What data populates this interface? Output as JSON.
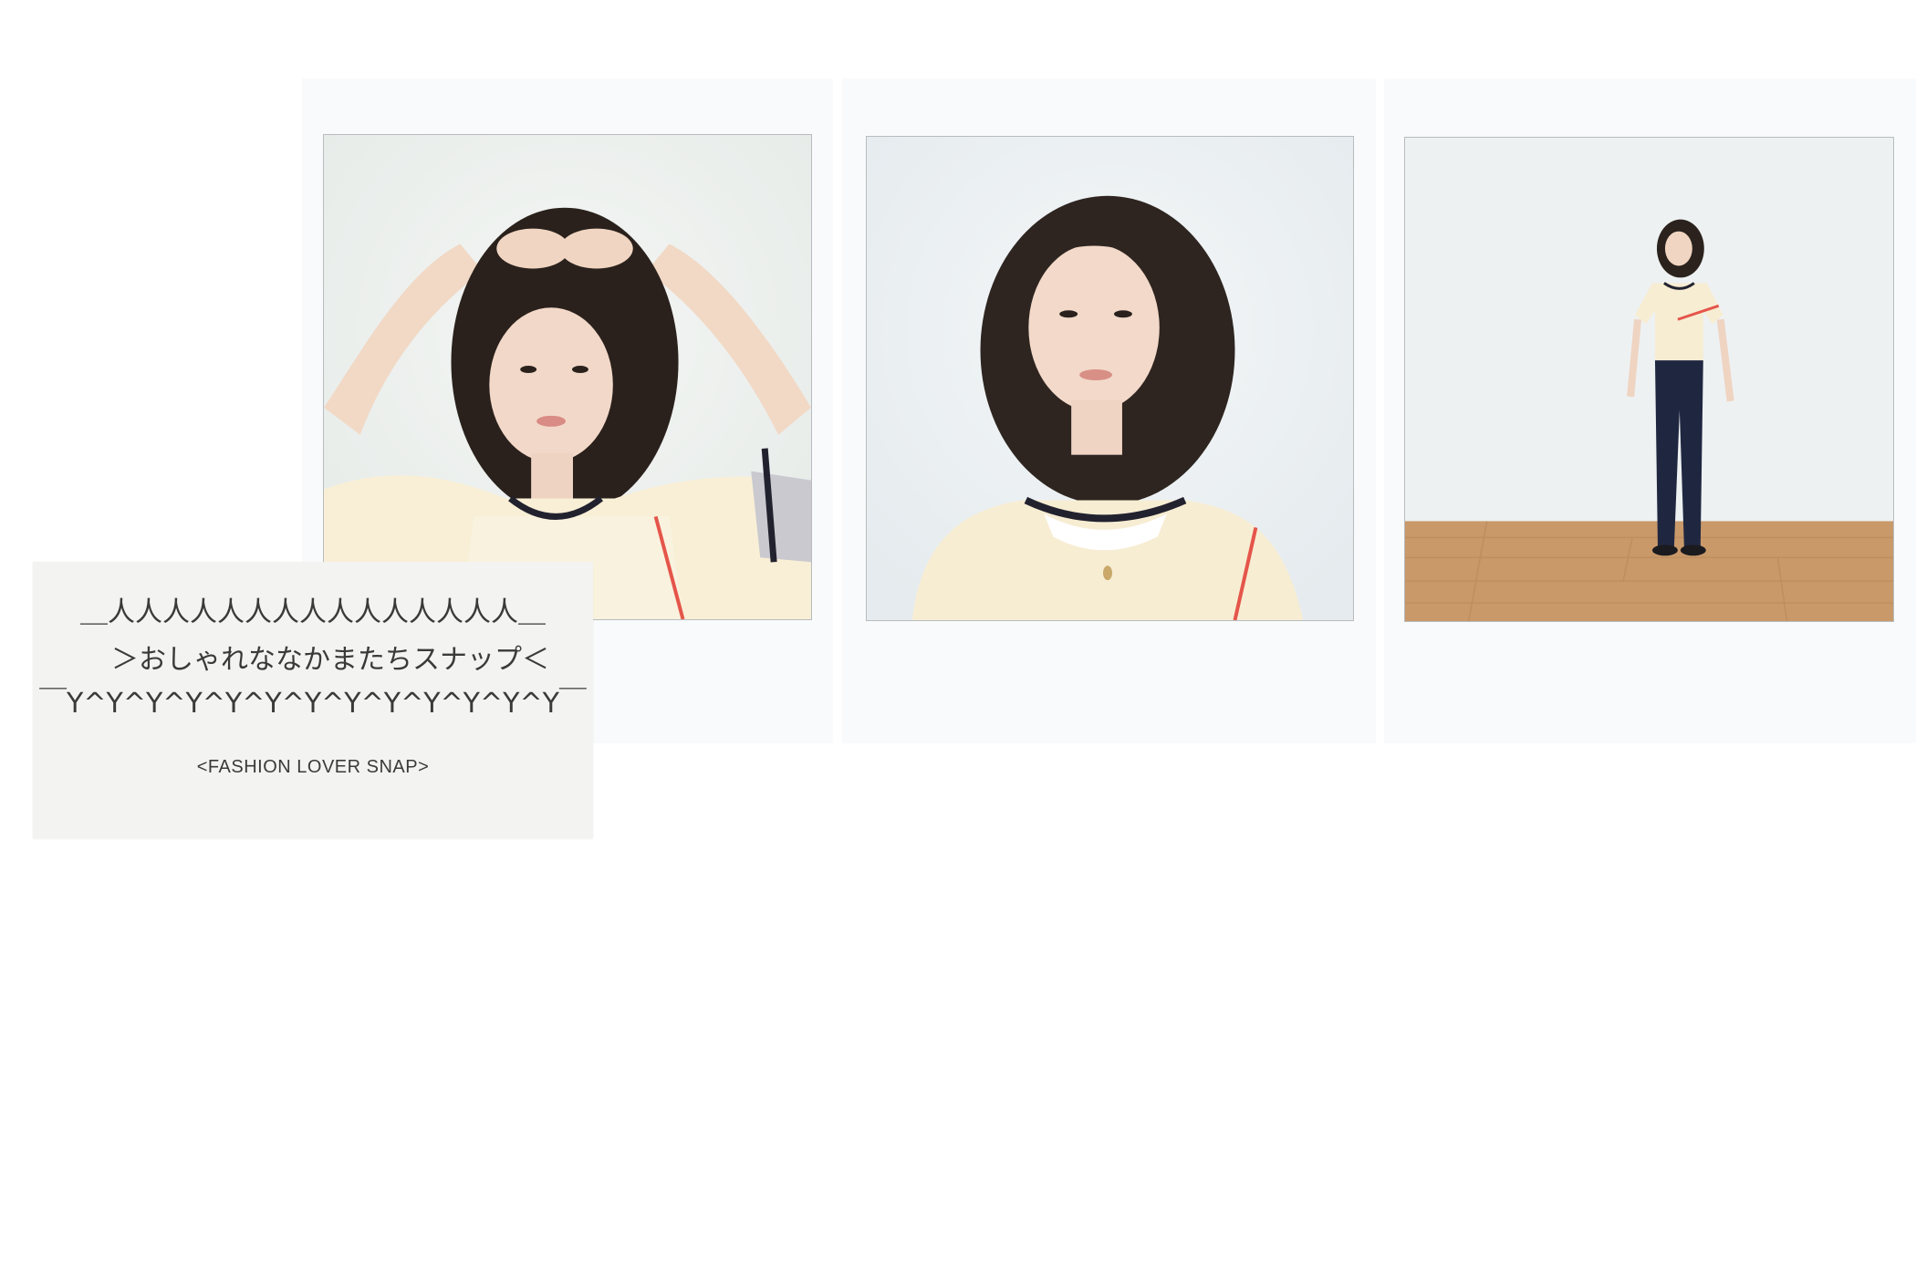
{
  "photos": [
    {
      "name": "film-photo-hands-on-head"
    },
    {
      "name": "film-photo-portrait"
    },
    {
      "name": "film-photo-full-body"
    }
  ],
  "card": {
    "top_border": "＿人人人人人人人人人人人人人人人＿",
    "left_bracket": "＞",
    "title": "おしゃれななかまたちスナップ",
    "right_bracket": "＜",
    "bottom_border": "￣Y^Y^Y^Y^Y^Y^Y^Y^Y^Y^Y^Y^Y￣",
    "subtitle": "<FASHION LOVER SNAP>"
  },
  "colors": {
    "background": "#ffffff",
    "film_frame": "#f9fafb",
    "card": "#f3f3f1",
    "text": "#3a3a3a"
  }
}
